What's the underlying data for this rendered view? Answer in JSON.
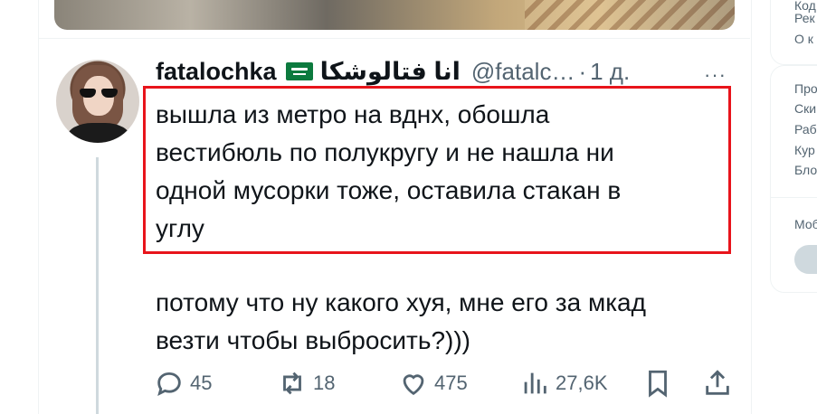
{
  "tweet": {
    "display_name": "fatalochka",
    "arabic_name": "انا فتالوشكا",
    "handle": "@fatalc…",
    "separator": "·",
    "time": "1 д.",
    "more": "···",
    "text_highlighted": "вышла из метро на вднх, обошла\nвестибюль по полукругу и не нашла ни\nодной мусорки тоже, оставила стакан в\nуглу",
    "text_second": "потому что ну какого хуя, мне его за мкад\nвезти чтобы выбросить?)))",
    "highlight_color": "#e8141b"
  },
  "actions": {
    "replies": "45",
    "reposts": "18",
    "likes": "475",
    "views": "27,6K"
  },
  "icons": [
    "reply-icon",
    "repost-icon",
    "like-icon",
    "views-icon",
    "bookmark-icon",
    "share-icon",
    "flag-icon"
  ],
  "sidebar": {
    "links_top": [
      "Код",
      "Рек",
      "О к"
    ],
    "links_mid": [
      "Про",
      "Ски",
      "Раб",
      "Кур",
      "Бло"
    ],
    "mobile_label": "Моб"
  }
}
